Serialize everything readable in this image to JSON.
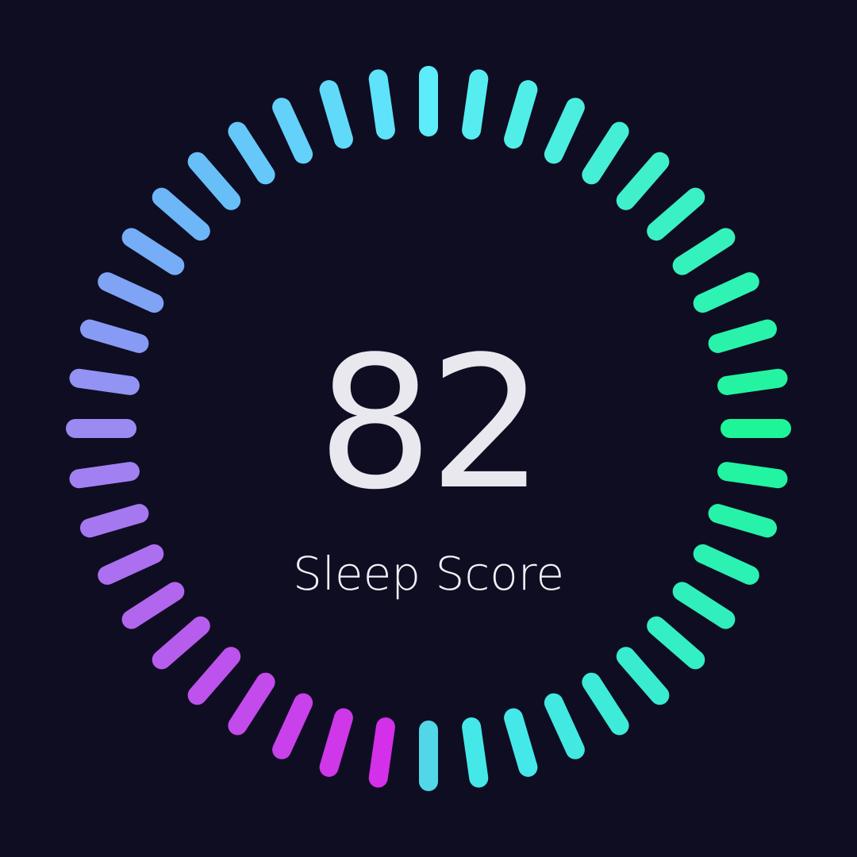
{
  "score": {
    "value": "82",
    "label": "Sleep Score"
  },
  "gauge": {
    "tick_count": 44,
    "start_color": "#5cecfa",
    "top_color": "#5cecfa",
    "right_color": "#1ef598",
    "bottom_right_color": "#45e8e8",
    "bottom_left_color": "#d72ae8",
    "left_color": "#9b8af2",
    "top_left_color": "#6ab8f8",
    "background": "#0f0d22",
    "text_color": "#e8e8ee"
  }
}
